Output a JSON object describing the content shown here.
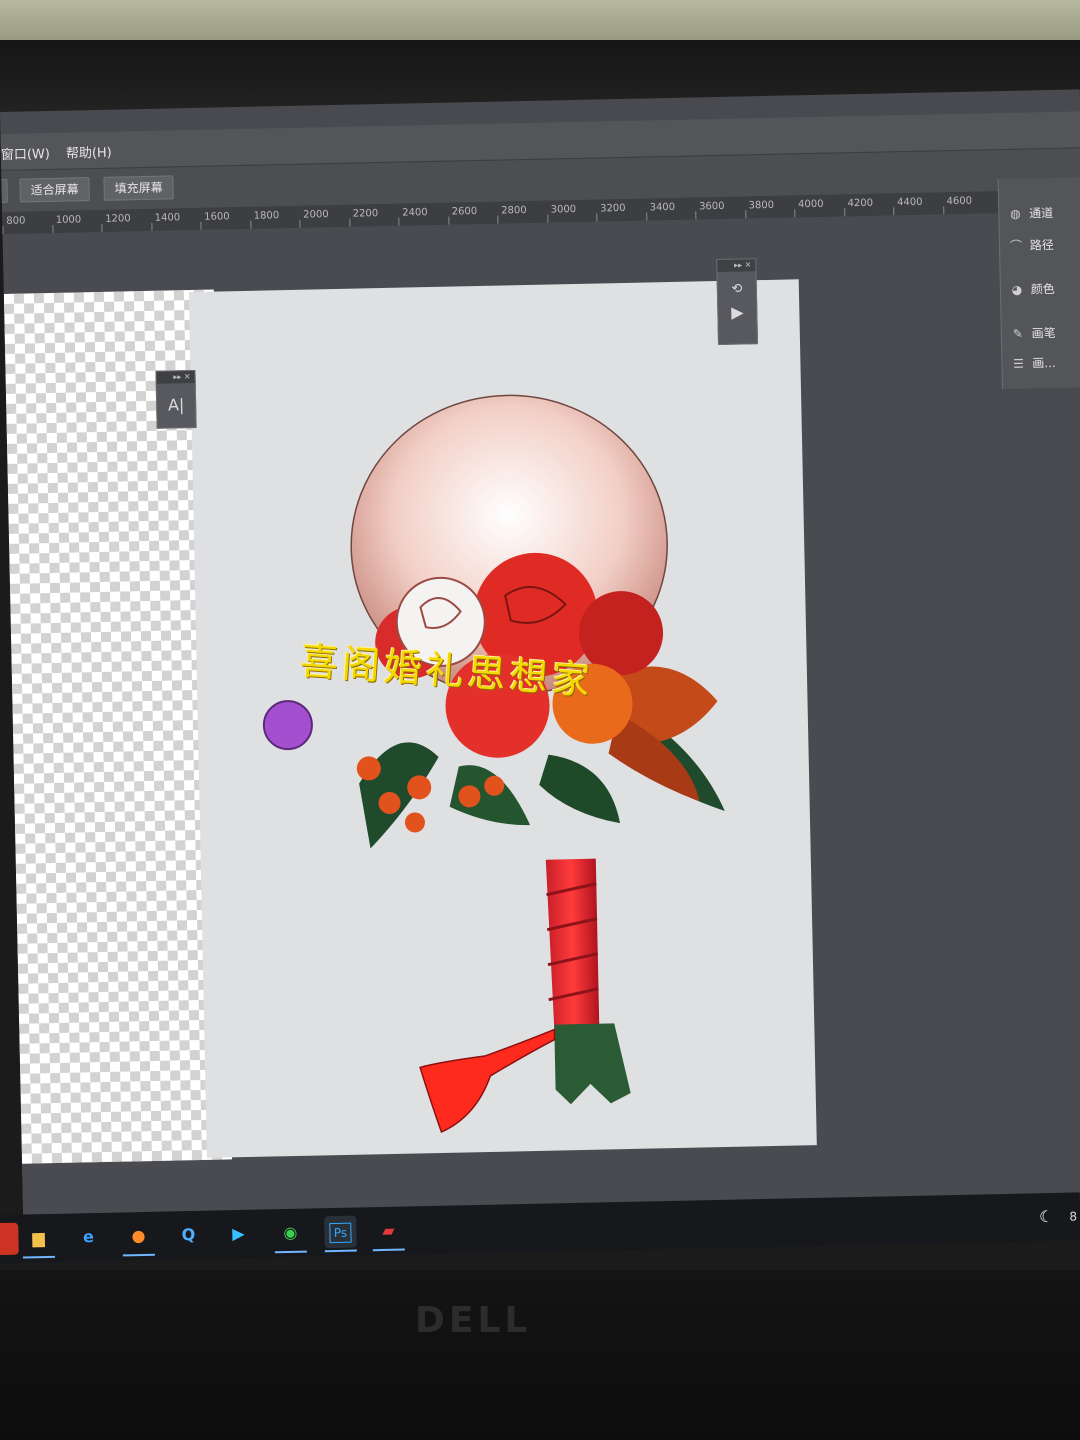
{
  "menu": {
    "window": "窗口(W)",
    "help": "帮助(H)"
  },
  "options": {
    "fit_screen": "适合屏幕",
    "fill_screen": "填充屏幕"
  },
  "ruler": {
    "ticks": [
      "800",
      "1000",
      "1200",
      "1400",
      "1600",
      "1800",
      "2000",
      "2200",
      "2400",
      "2600",
      "2800",
      "3000",
      "3200",
      "3400",
      "3600",
      "3800",
      "4000",
      "4200",
      "4400",
      "4600"
    ]
  },
  "char_panel": {
    "glyph": "A|"
  },
  "actions_panel": {
    "play": "▶"
  },
  "right_panel": {
    "items": [
      {
        "label": "通道",
        "icon": "channels-icon"
      },
      {
        "label": "路径",
        "icon": "paths-icon"
      },
      {
        "label": "颜色",
        "icon": "color-icon"
      },
      {
        "label": "画笔",
        "icon": "brush-icon"
      },
      {
        "label": "画...",
        "icon": "brush-settings-icon"
      }
    ]
  },
  "watermark": "喜阁婚礼思想家",
  "taskbar": {
    "clock_fragment": "8"
  },
  "monitor_logo": "DELL"
}
